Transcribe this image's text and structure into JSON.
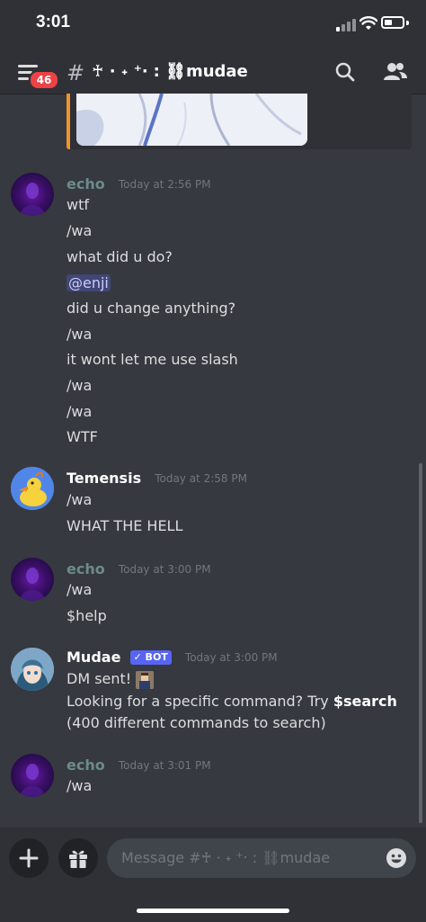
{
  "status_bar": {
    "time": "3:01"
  },
  "header": {
    "badge_count": "46",
    "channel_prefix": "#",
    "channel_name": "♰ · ˖ ⁺‧ : ⛓mudae"
  },
  "messages": [
    {
      "author": "echo",
      "timestamp": "Today at 2:56 PM",
      "lines": [
        "wtf",
        "/wa",
        "what did u do?",
        "@enji",
        "did u change anything?",
        "/wa",
        "it wont let me use slash",
        "/wa",
        "/wa",
        "WTF"
      ]
    },
    {
      "author": "Temensis",
      "timestamp": "Today at 2:58 PM",
      "lines": [
        "/wa",
        "WHAT THE HELL"
      ]
    },
    {
      "author": "echo",
      "timestamp": "Today at 3:00 PM",
      "lines": [
        "/wa",
        "$help"
      ]
    },
    {
      "author": "Mudae",
      "bot_tag": "✓ BOT",
      "timestamp": "Today at 3:00 PM",
      "line1": "DM sent!",
      "line2_prefix": "Looking for a specific command? Try ",
      "line2_bold": "$search",
      "line3": "(400 different commands to search)"
    },
    {
      "author": "echo",
      "timestamp": "Today at 3:01 PM",
      "lines": [
        "/wa"
      ]
    }
  ],
  "composer": {
    "placeholder": "Message #♰ · ˖ ⁺‧ : ⛓mudae"
  },
  "colors": {
    "background": "#36393f",
    "header": "#2f3136",
    "mention_bg": "#414675",
    "mention_text": "#c9cdfb",
    "bot_tag": "#5865f2",
    "badge": "#ed4245",
    "echo_name": "#6c8b8a",
    "embed_border": "#f0932b"
  },
  "icons": [
    "menu-icon",
    "search-icon",
    "members-icon",
    "plus-icon",
    "gift-icon",
    "emoji-icon"
  ]
}
